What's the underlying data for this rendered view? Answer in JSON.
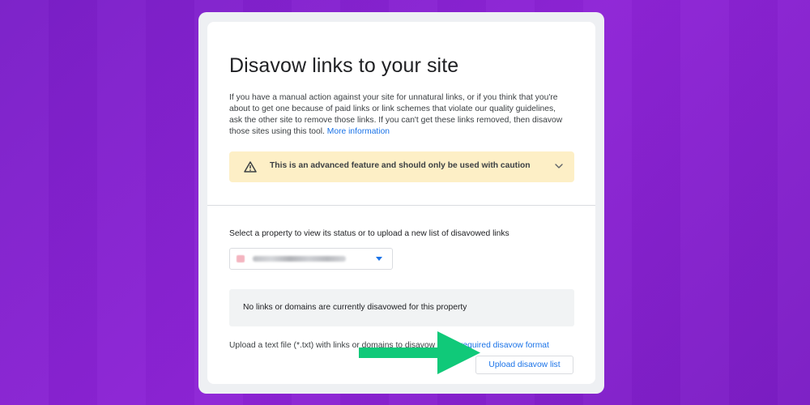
{
  "page": {
    "title": "Disavow links to your site"
  },
  "intro": {
    "text": "If you have a manual action against your site for unnatural links, or if you think that you're about to get one because of paid links or link schemes that violate our quality guidelines, ask the other site to remove those links. If you can't get these links removed, then disavow those sites using this tool. ",
    "more_info_link": "More information"
  },
  "warning": {
    "icon": "warning-triangle-icon",
    "text": "This is an advanced feature and should only be used with caution",
    "expand_icon": "chevron-down-icon",
    "background": "#fdefc6"
  },
  "property_select": {
    "label": "Select a property to view its status or to upload a new list of disavowed links",
    "selected_value_blurred": true,
    "arrow_icon": "dropdown-arrow-icon"
  },
  "status": {
    "message": "No links or domains are currently disavowed for this property"
  },
  "upload": {
    "instructions_prefix": "Upload a text file (*.txt) with links or domains to disavow in the ",
    "format_link": "required disavow format",
    "button_label": "Upload disavow list"
  },
  "annotation": {
    "arrow_color": "#10c979",
    "arrow_icon": "right-arrow-icon"
  },
  "colors": {
    "accent": "#1a73e8",
    "background_purple": "#8a24d4"
  }
}
